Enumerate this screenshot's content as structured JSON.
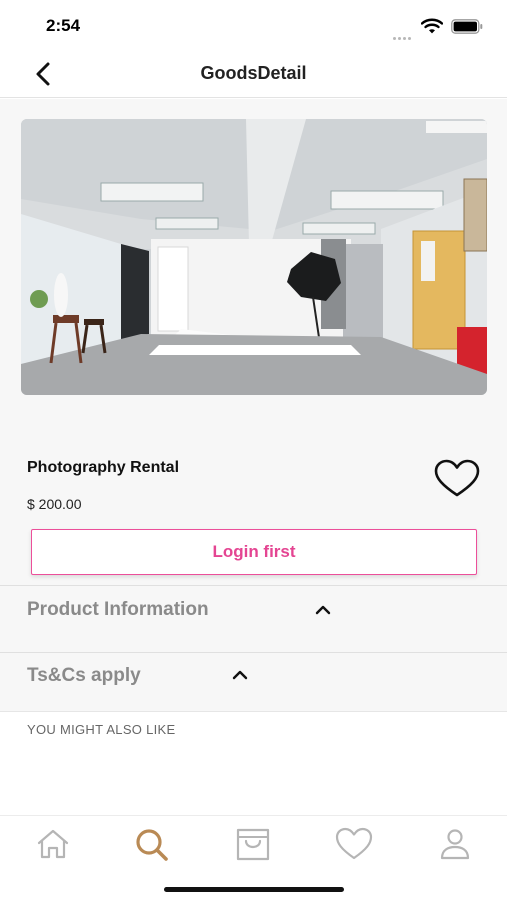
{
  "status_bar": {
    "time": "2:54"
  },
  "nav": {
    "title": "GoodsDetail"
  },
  "product": {
    "title": "Photography Rental",
    "price": "$ 200.00",
    "login_label": "Login first"
  },
  "sections": {
    "product_information": "Product Information",
    "terms": "Ts&Cs apply"
  },
  "recommendations": {
    "heading": "YOU MIGHT ALSO LIKE"
  },
  "tab_bar": {
    "items": [
      "home-icon",
      "search-icon",
      "cart-icon",
      "heart-icon",
      "profile-icon"
    ],
    "active": "search-icon"
  },
  "colors": {
    "accent_pink": "#e44592",
    "tab_active": "#b98a55",
    "tab_inactive": "#b5b5b5"
  }
}
